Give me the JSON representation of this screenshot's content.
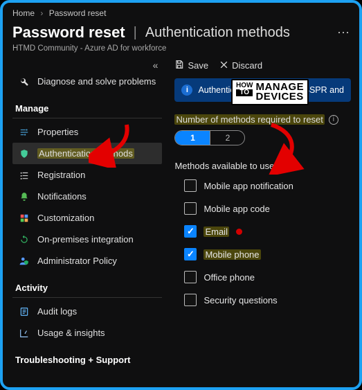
{
  "breadcrumb": {
    "home": "Home",
    "current": "Password reset"
  },
  "title": {
    "main": "Password reset",
    "sub": "Authentication methods"
  },
  "subtitle": "HTMD Community - Azure AD for workforce",
  "sidebar": {
    "diagnose": "Diagnose and solve problems",
    "sections": {
      "manage": "Manage",
      "activity": "Activity",
      "troubleshoot": "Troubleshooting + Support"
    },
    "items": {
      "properties": "Properties",
      "auth_methods": "Authentication methods",
      "registration": "Registration",
      "notifications": "Notifications",
      "customization": "Customization",
      "onprem": "On-premises integration",
      "admin_policy": "Administrator Policy",
      "audit_logs": "Audit logs",
      "usage": "Usage & insights"
    }
  },
  "toolbar": {
    "save": "Save",
    "discard": "Discard"
  },
  "banner": "Authentication Methods for SSPR and",
  "methods_required": {
    "label": "Number of methods required to reset",
    "opt1": "1",
    "opt2": "2",
    "selected": 1
  },
  "methods_available": {
    "label": "Methods available to users",
    "items": {
      "app_notif": {
        "label": "Mobile app notification",
        "checked": false
      },
      "app_code": {
        "label": "Mobile app code",
        "checked": false
      },
      "email": {
        "label": "Email",
        "checked": true
      },
      "mobile_phone": {
        "label": "Mobile phone",
        "checked": true
      },
      "office_phone": {
        "label": "Office phone",
        "checked": false
      },
      "sec_q": {
        "label": "Security questions",
        "checked": false
      }
    }
  },
  "logo": {
    "how": "HOW",
    "to": "TO",
    "manage": "MANAGE",
    "devices": "DEVICES"
  }
}
